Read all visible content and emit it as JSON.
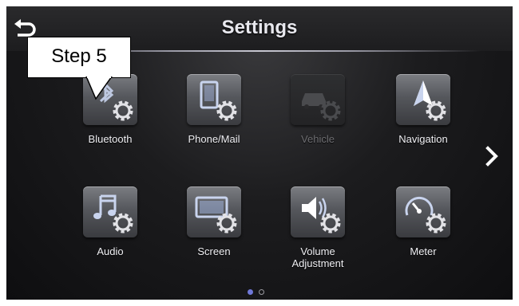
{
  "header": {
    "title": "Settings"
  },
  "callout": {
    "text": "Step 5"
  },
  "tiles": [
    {
      "label": "Bluetooth",
      "icon": "bluetooth-settings-icon",
      "enabled": true
    },
    {
      "label": "Phone/Mail",
      "icon": "phone-settings-icon",
      "enabled": true
    },
    {
      "label": "Vehicle",
      "icon": "vehicle-settings-icon",
      "enabled": false
    },
    {
      "label": "Navigation",
      "icon": "navigation-settings-icon",
      "enabled": true
    },
    {
      "label": "Audio",
      "icon": "audio-settings-icon",
      "enabled": true
    },
    {
      "label": "Screen",
      "icon": "screen-settings-icon",
      "enabled": true
    },
    {
      "label": "Volume\nAdjustment",
      "icon": "volume-settings-icon",
      "enabled": true
    },
    {
      "label": "Meter",
      "icon": "meter-settings-icon",
      "enabled": true
    }
  ],
  "pagination": {
    "current_page": 1,
    "total_pages": 2
  },
  "colors": {
    "active_dot": "#6f78d8",
    "inactive_dot": "#9a9aa0",
    "gear": "#e2e2e6"
  }
}
